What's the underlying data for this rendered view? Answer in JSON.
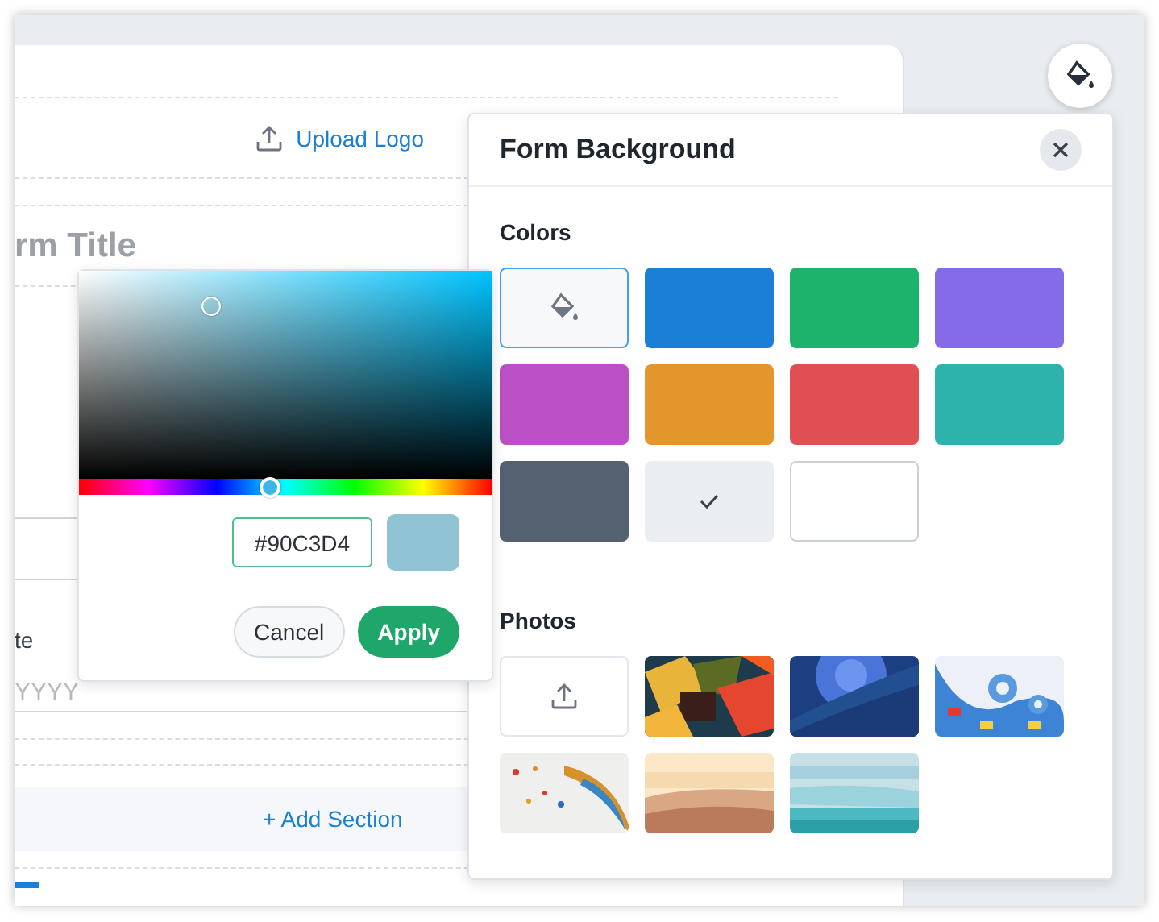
{
  "form": {
    "upload_logo": "Upload Logo",
    "title": "rm Title",
    "field_label": "te",
    "date_placeholder": "YYYY",
    "add_section": "+ Add Section"
  },
  "panel": {
    "title": "Form Background",
    "colors_heading": "Colors",
    "swatches": [
      {
        "kind": "custom",
        "selected": false
      },
      {
        "kind": "color",
        "color": "#1b7fd8",
        "selected": false
      },
      {
        "kind": "color",
        "color": "#1db36d",
        "selected": false
      },
      {
        "kind": "color",
        "color": "#866be8",
        "selected": false
      },
      {
        "kind": "color",
        "color": "#bb4fc6",
        "selected": false
      },
      {
        "kind": "color",
        "color": "#e2962b",
        "selected": false
      },
      {
        "kind": "color",
        "color": "#e04f51",
        "selected": false
      },
      {
        "kind": "color",
        "color": "#2eb2ac",
        "selected": false
      },
      {
        "kind": "color",
        "color": "#536170",
        "selected": false
      },
      {
        "kind": "color",
        "color": "#eaedf1",
        "selected": true
      },
      {
        "kind": "color",
        "color": "#ffffff",
        "selected": false
      }
    ],
    "photos_heading": "Photos",
    "photos": [
      {
        "kind": "upload"
      },
      {
        "kind": "picture"
      },
      {
        "kind": "picture"
      },
      {
        "kind": "picture"
      },
      {
        "kind": "picture"
      },
      {
        "kind": "picture"
      },
      {
        "kind": "picture"
      }
    ]
  },
  "picker": {
    "saturation": {
      "level": 0.32
    },
    "hue": {
      "level": 0.46
    },
    "hex": "#90C3D4",
    "cancel": "Cancel",
    "apply": "Apply"
  }
}
